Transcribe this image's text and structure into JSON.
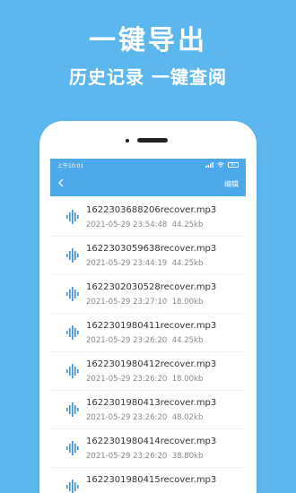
{
  "promo": {
    "headline": "一键导出",
    "subline": "历史记录  一键查阅"
  },
  "statusbar": {
    "time": "上午10:01",
    "battery": "97"
  },
  "navbar": {
    "back_icon": "back-chevron-icon",
    "edit_label": "编辑"
  },
  "colors": {
    "background": "#5bb7ee",
    "header": "#4ea9ea",
    "accent": "#3b8fd9"
  },
  "files": [
    {
      "name": "1622303688206recover.mp3",
      "date": "2021-05-29 23:54:48",
      "size": "44.25kb"
    },
    {
      "name": "1622303059638recover.mp3",
      "date": "2021-05-29 23:44:19",
      "size": "44.25kb"
    },
    {
      "name": "1622302030528recover.mp3",
      "date": "2021-05-29 23:27:10",
      "size": "18.00kb"
    },
    {
      "name": "1622301980411recover.mp3",
      "date": "2021-05-29 23:26:20",
      "size": "44.25kb"
    },
    {
      "name": "1622301980412recover.mp3",
      "date": "2021-05-29 23:26:20",
      "size": "18.00kb"
    },
    {
      "name": "1622301980413recover.mp3",
      "date": "2021-05-29 23:26:20",
      "size": "48.02kb"
    },
    {
      "name": "1622301980414recover.mp3",
      "date": "2021-05-29 23:26:20",
      "size": "38.80kb"
    },
    {
      "name": "1622301980415recover.mp3",
      "date": "",
      "size": ""
    }
  ]
}
